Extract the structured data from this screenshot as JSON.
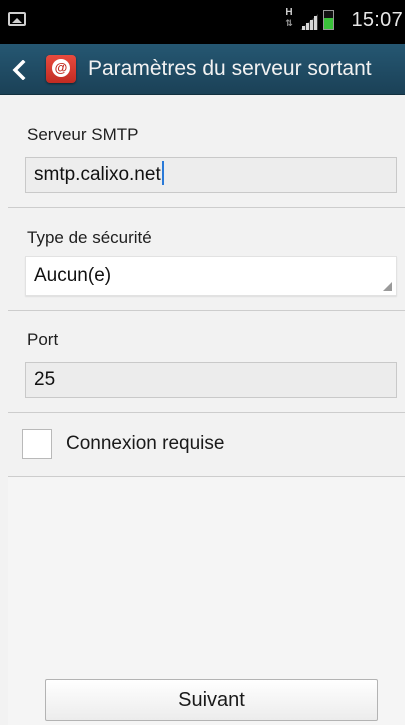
{
  "status_bar": {
    "network_type": "H",
    "time": "15:07",
    "battery_level": 0.6,
    "icons": [
      "screenshot-icon",
      "network-type-icon",
      "signal-icon",
      "battery-icon"
    ]
  },
  "action_bar": {
    "title": "Paramètres du serveur sortant",
    "app_icon": "email-app-icon",
    "back_icon": "chevron-left-icon",
    "background": "#1f4a63",
    "app_icon_color": "#d6372d"
  },
  "form": {
    "smtp": {
      "label": "Serveur SMTP",
      "value": "smtp.calixo.net"
    },
    "security": {
      "label": "Type de sécurité",
      "selected": "Aucun(e)"
    },
    "port": {
      "label": "Port",
      "value": "25"
    },
    "auth": {
      "label": "Connexion requise",
      "checked": false
    }
  },
  "actions": {
    "next_label": "Suivant"
  },
  "colors": {
    "caret": "#2a7ad8",
    "battery": "#3ac23a"
  }
}
